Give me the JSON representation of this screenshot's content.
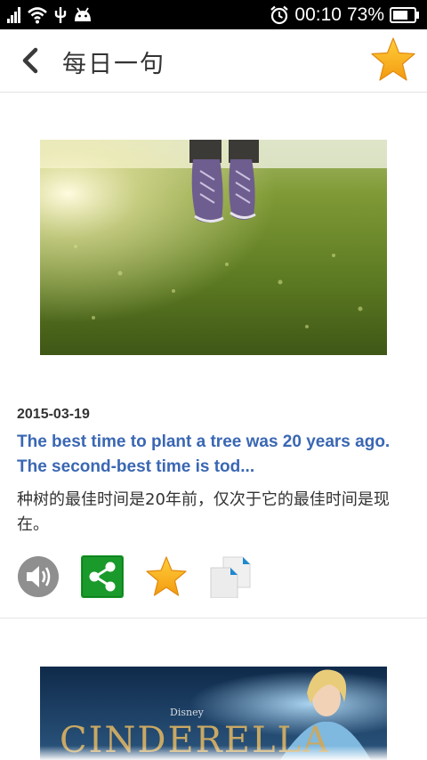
{
  "status_bar": {
    "time": "00:10",
    "battery": "73%",
    "battery_level": 0.73
  },
  "header": {
    "title": "每日一句",
    "back_icon": "chevron-left-icon",
    "favorite_icon": "star-icon"
  },
  "entry": {
    "date": "2015-03-19",
    "english": "The best time to plant a tree was 20 years ago. The second-best time is tod...",
    "chinese": "种树的最佳时间是20年前，仅次于它的最佳时间是现在。",
    "actions": [
      "speaker-icon",
      "share-icon",
      "star-icon",
      "copy-icon"
    ]
  },
  "next_entry": {
    "poster_brand": "Disney",
    "poster_title": "CINDERELLA"
  },
  "colors": {
    "link_blue": "#3a67b3",
    "share_green": "#1a9a2a",
    "star_orange": "#f7a21a"
  }
}
